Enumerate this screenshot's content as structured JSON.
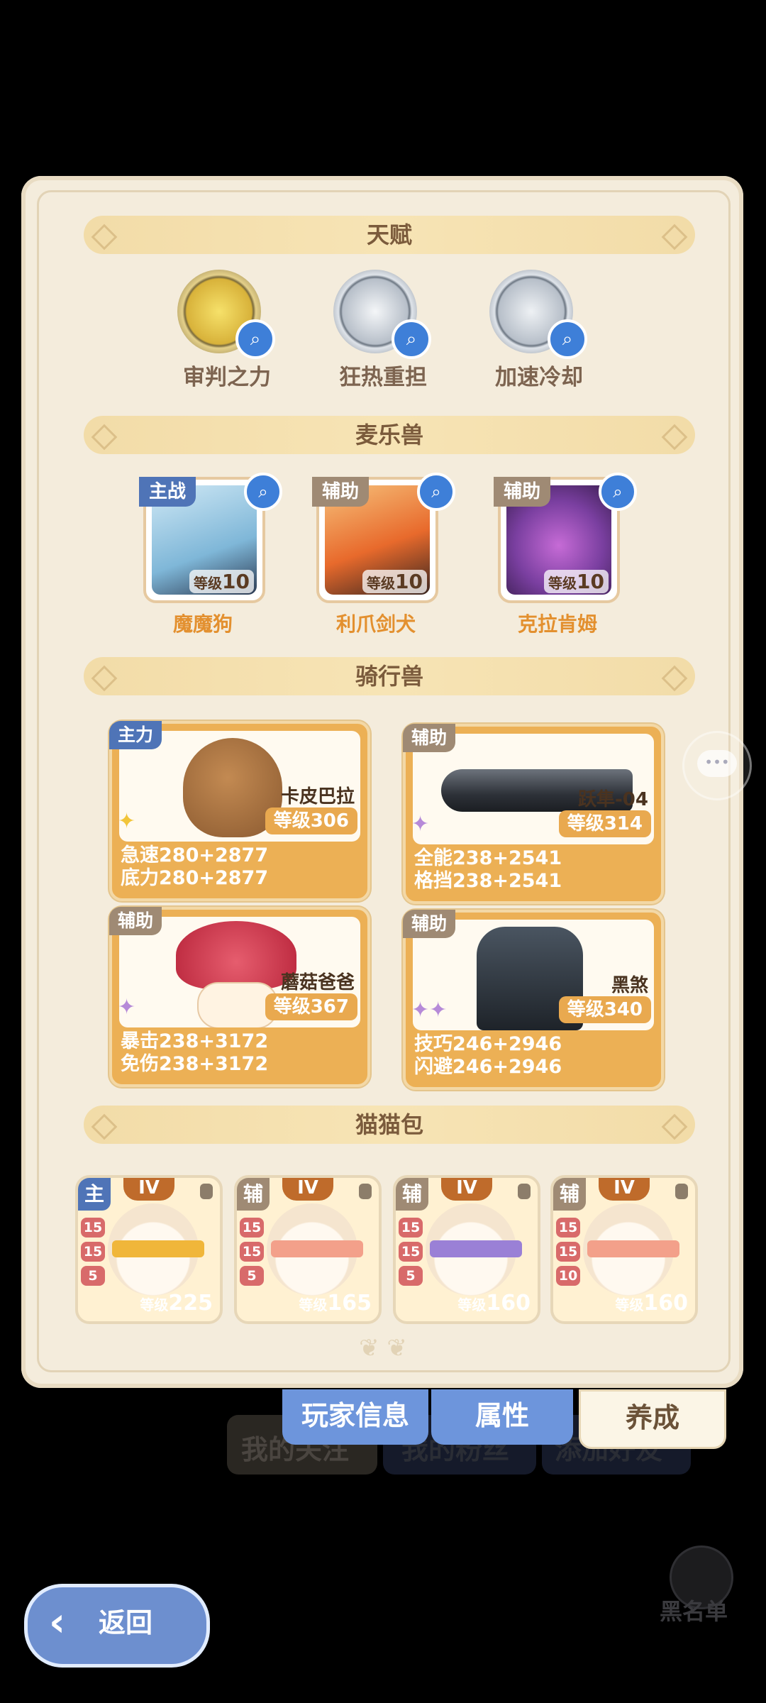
{
  "sections": {
    "talent": "天赋",
    "pets": "麦乐兽",
    "mounts": "骑行兽",
    "cats": "猫猫包"
  },
  "talents": [
    {
      "name": "审判之力",
      "color": "#d6b43a"
    },
    {
      "name": "狂热重担",
      "color": "#a7b1bd"
    },
    {
      "name": "加速冷却",
      "color": "#a7b1bd"
    }
  ],
  "pets": [
    {
      "tag": "主战",
      "tag_color": "#4f74b7",
      "level_label": "等级",
      "level": "10",
      "name": "魔魔狗"
    },
    {
      "tag": "辅助",
      "tag_color": "#9f8a74",
      "level_label": "等级",
      "level": "10",
      "name": "利爪剑犬"
    },
    {
      "tag": "辅助",
      "tag_color": "#9f8a74",
      "level_label": "等级",
      "level": "10",
      "name": "克拉肯姆"
    }
  ],
  "mounts": [
    {
      "tag": "主力",
      "tag_color": "#4f74b7",
      "name": "卡皮巴拉",
      "level": "等级306",
      "stat1": "急速280+2877",
      "stat2": "底力280+2877"
    },
    {
      "tag": "辅助",
      "tag_color": "#9f8a74",
      "name": "跃隼-04",
      "level": "等级314",
      "stat1": "全能238+2541",
      "stat2": "格挡238+2541"
    },
    {
      "tag": "辅助",
      "tag_color": "#9f8a74",
      "name": "蘑菇爸爸",
      "level": "等级367",
      "stat1": "暴击238+3172",
      "stat2": "免伤238+3172"
    },
    {
      "tag": "辅助",
      "tag_color": "#9f8a74",
      "name": "黑煞",
      "level": "等级340",
      "stat1": "技巧246+2946",
      "stat2": "闪避246+2946"
    }
  ],
  "cats": [
    {
      "tag": "主",
      "tag_color": "#4f74b7",
      "tier": "IV",
      "lv1": "15",
      "lv2": "15",
      "lv3": "5",
      "level_label": "等级",
      "level": "225",
      "band": "#f0b63a"
    },
    {
      "tag": "辅",
      "tag_color": "#9f8a74",
      "tier": "IV",
      "lv1": "15",
      "lv2": "15",
      "lv3": "5",
      "level_label": "等级",
      "level": "165",
      "band": "#f3a08a"
    },
    {
      "tag": "辅",
      "tag_color": "#9f8a74",
      "tier": "IV",
      "lv1": "15",
      "lv2": "15",
      "lv3": "5",
      "level_label": "等级",
      "level": "160",
      "band": "#9a80d6"
    },
    {
      "tag": "辅",
      "tag_color": "#9f8a74",
      "tier": "IV",
      "lv1": "15",
      "lv2": "15",
      "lv3": "10",
      "level_label": "等级",
      "level": "160",
      "band": "#f3a08a"
    }
  ],
  "tabs": {
    "player_info": "玩家信息",
    "attributes": "属性",
    "growth": "养成"
  },
  "background": {
    "my_follow": "我的关注",
    "my_fans": "我的粉丝",
    "add_friend": "添加好友",
    "blacklist": "黑名单"
  },
  "back_label": "返回",
  "colors": {
    "accent_blue": "#6d8fcf",
    "card_bg": "#f4ecdc",
    "orange": "#ecb055"
  }
}
